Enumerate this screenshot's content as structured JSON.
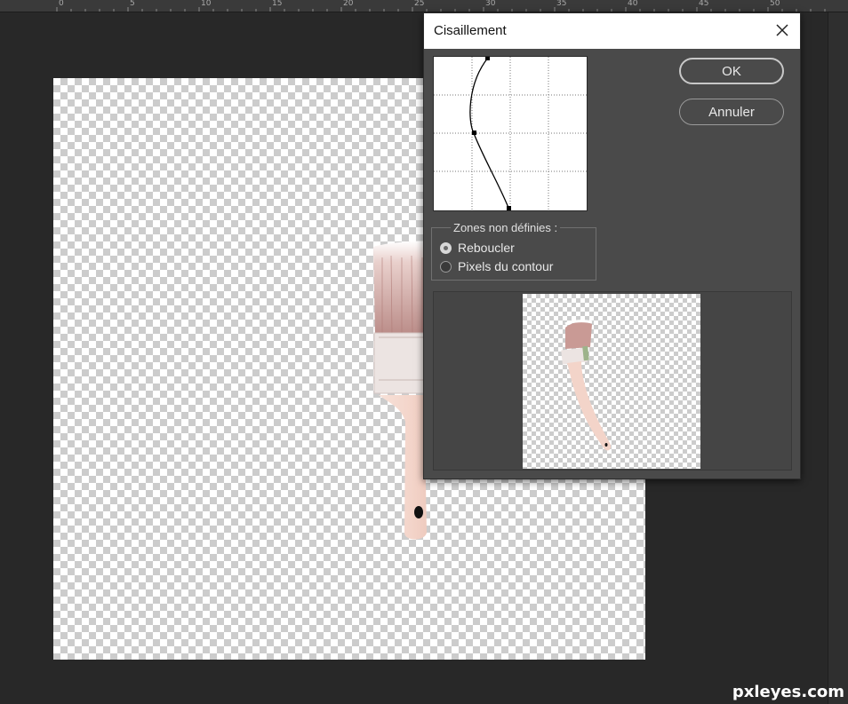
{
  "ruler": {
    "labels": [
      "0",
      "5",
      "10",
      "15",
      "20",
      "25",
      "30",
      "35",
      "40",
      "45",
      "50"
    ]
  },
  "dialog": {
    "title": "Cisaillement",
    "ok_label": "OK",
    "cancel_label": "Annuler",
    "undefined_areas": {
      "legend": "Zones non définies :",
      "options": [
        {
          "label": "Reboucler",
          "checked": true
        },
        {
          "label": "Pixels du contour",
          "checked": false
        }
      ]
    }
  },
  "watermark": "pxleyes.com",
  "colors": {
    "workspace_bg": "#282828",
    "dialog_bg": "#4a4a4a",
    "brush_bristles": "#c99a95",
    "brush_handle": "#f3d6cb",
    "ferrule": "#ece4e2",
    "tape_green": "#9db38a"
  },
  "icons": {
    "close": "close-icon"
  }
}
